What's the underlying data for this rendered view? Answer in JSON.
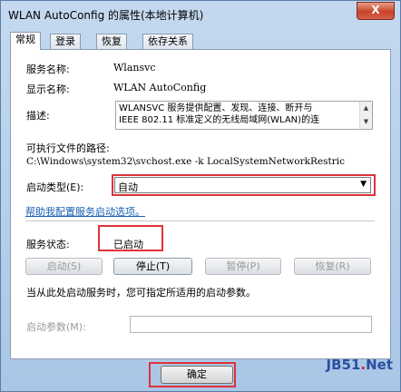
{
  "window": {
    "title": "WLAN AutoConfig 的属性(本地计算机)",
    "close_label": "X"
  },
  "tabs": [
    {
      "label": "常规"
    },
    {
      "label": "登录"
    },
    {
      "label": "恢复"
    },
    {
      "label": "依存关系"
    }
  ],
  "general": {
    "service_name_label": "服务名称:",
    "service_name": "Wlansvc",
    "display_name_label": "显示名称:",
    "display_name": "WLAN AutoConfig",
    "description_label": "描述:",
    "description_line1": "WLANSVC 服务提供配置、发现、连接、断开与",
    "description_line2": "IEEE 802.11 标准定义的无线局域网(WLAN)的连",
    "exe_path_label": "可执行文件的路径:",
    "exe_path": "C:\\Windows\\system32\\svchost.exe -k LocalSystemNetworkRestric",
    "startup_type_label": "启动类型(E):",
    "startup_type_value": "自动",
    "help_link": "帮助我配置服务启动选项。",
    "status_label": "服务状态:",
    "status_value": "已启动",
    "buttons": {
      "start": "启动(S)",
      "stop": "停止(T)",
      "pause": "暂停(P)",
      "resume": "恢复(R)"
    },
    "hint_text": "当从此处启动服务时，您可指定所适用的启动参数。",
    "start_params_label": "启动参数(M):",
    "start_params_value": ""
  },
  "footer": {
    "ok_label": "确定"
  },
  "watermark": {
    "part1": "JB51",
    "part2": ".",
    "part3": "Net"
  },
  "colors": {
    "highlight_box": "#e0323a",
    "link": "#1a5fb4",
    "titlebar": "#c4d9ef"
  }
}
